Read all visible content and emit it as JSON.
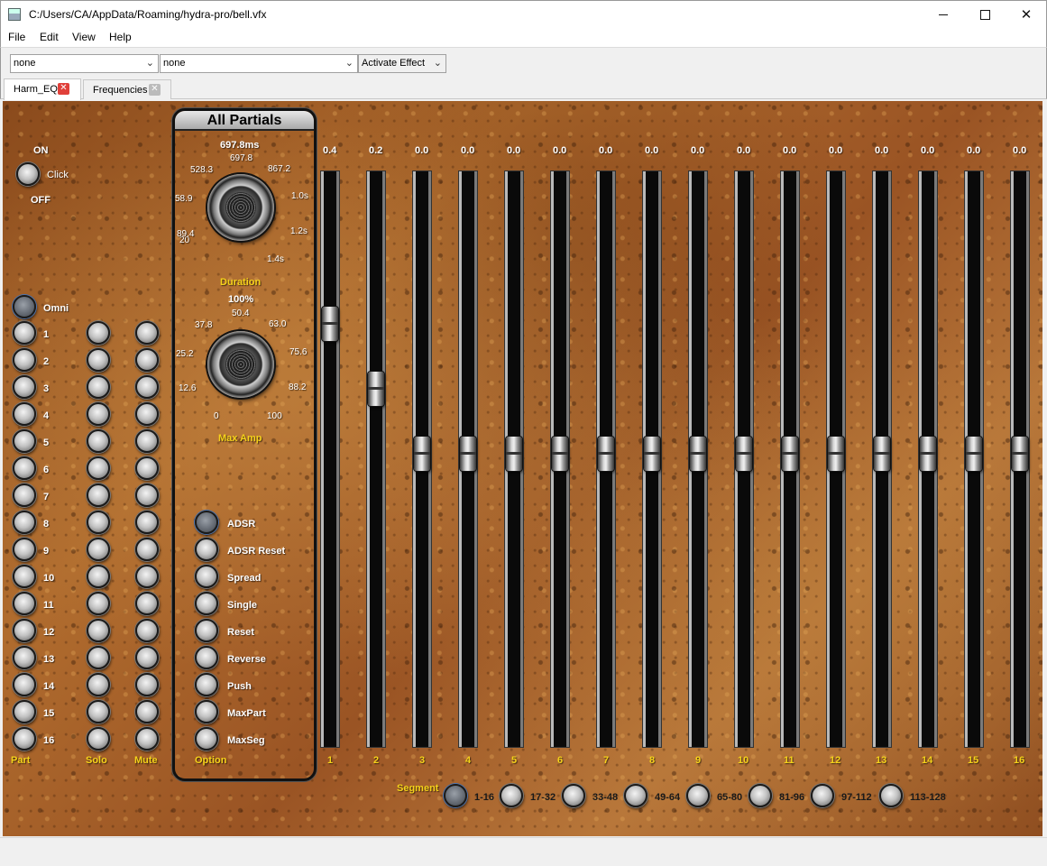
{
  "window": {
    "title": "C:/Users/CA/AppData/Roaming/hydra-pro/bell.vfx"
  },
  "menu": [
    {
      "label": "File"
    },
    {
      "label": "Edit"
    },
    {
      "label": "View"
    },
    {
      "label": "Help"
    }
  ],
  "toolbar": {
    "combo1": "none",
    "combo2": "none",
    "effect": "Activate Effect"
  },
  "tabs": [
    {
      "label": "Harm_EQ",
      "active": true
    },
    {
      "label": "Frequencies",
      "active": false
    }
  ],
  "power": {
    "on": "ON",
    "click": "Click",
    "off": "OFF"
  },
  "omni": "Omni",
  "parts": [
    "1",
    "2",
    "3",
    "4",
    "5",
    "6",
    "7",
    "8",
    "9",
    "10",
    "11",
    "12",
    "13",
    "14",
    "15",
    "16"
  ],
  "columns": {
    "part": "Part",
    "solo": "Solo",
    "mute": "Mute",
    "option": "Option"
  },
  "module": {
    "title": "All Partials",
    "duration": {
      "value": "697.8ms",
      "label": "Duration",
      "ticks": [
        "20",
        "89.4",
        "58.9",
        "528.3",
        "697.8",
        "867.2",
        "1.0s",
        "1.2s",
        "1.4s"
      ]
    },
    "maxamp": {
      "value": "100%",
      "label": "Max Amp",
      "ticks": [
        "0",
        "12.6",
        "25.2",
        "37.8",
        "50.4",
        "63.0",
        "75.6",
        "88.2",
        "100"
      ]
    },
    "options": [
      "ADSR",
      "ADSR Reset",
      "Spread",
      "Single",
      "Reset",
      "Reverse",
      "Push",
      "MaxPart",
      "MaxSeg"
    ]
  },
  "sliders": [
    {
      "label": "1",
      "value": "0.4",
      "level": 0.4
    },
    {
      "label": "2",
      "value": "0.2",
      "level": 0.2
    },
    {
      "label": "3",
      "value": "0.0",
      "level": 0.0
    },
    {
      "label": "4",
      "value": "0.0",
      "level": 0.0
    },
    {
      "label": "5",
      "value": "0.0",
      "level": 0.0
    },
    {
      "label": "6",
      "value": "0.0",
      "level": 0.0
    },
    {
      "label": "7",
      "value": "0.0",
      "level": 0.0
    },
    {
      "label": "8",
      "value": "0.0",
      "level": 0.0
    },
    {
      "label": "9",
      "value": "0.0",
      "level": 0.0
    },
    {
      "label": "10",
      "value": "0.0",
      "level": 0.0
    },
    {
      "label": "11",
      "value": "0.0",
      "level": 0.0
    },
    {
      "label": "12",
      "value": "0.0",
      "level": 0.0
    },
    {
      "label": "13",
      "value": "0.0",
      "level": 0.0
    },
    {
      "label": "14",
      "value": "0.0",
      "level": 0.0
    },
    {
      "label": "15",
      "value": "0.0",
      "level": 0.0
    },
    {
      "label": "16",
      "value": "0.0",
      "level": 0.0
    }
  ],
  "segment": {
    "label": "Segment",
    "options": [
      "1-16",
      "17-32",
      "33-48",
      "49-64",
      "65-80",
      "81-96",
      "97-112",
      "113-128"
    ],
    "selected": 0
  }
}
